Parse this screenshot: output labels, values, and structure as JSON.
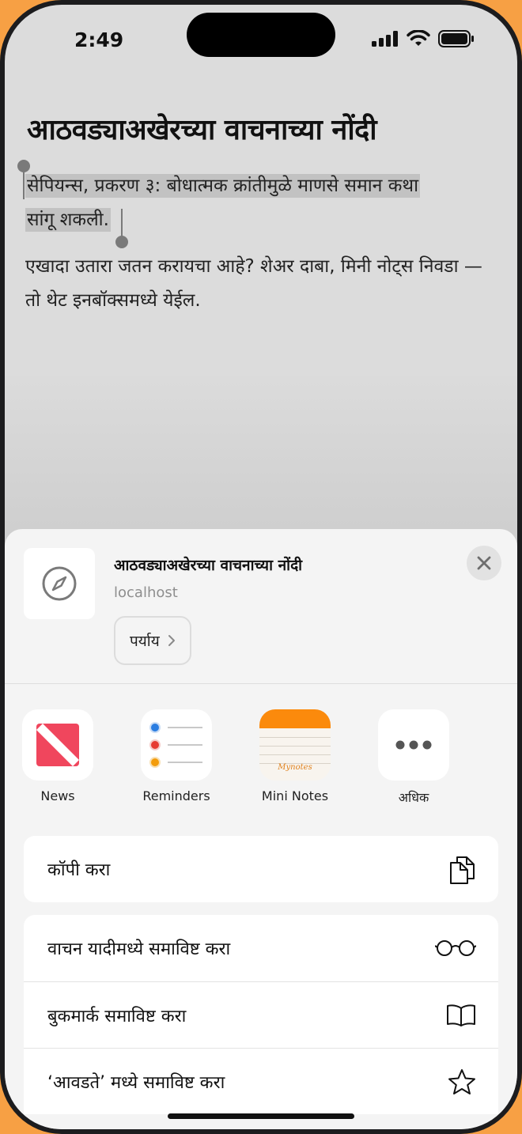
{
  "status": {
    "time": "2:49"
  },
  "page": {
    "heading": "आठवड्याअखेरच्या वाचनाच्या नोंदी",
    "selected_line1": "सेपियन्स, प्रकरण ३: बोधात्मक क्रांतीमुळे माणसे समान कथा",
    "selected_line2": "सांगू शकली.",
    "body": "एखादा उतारा जतन करायचा आहे? शेअर दाबा, मिनी नोट्स निवडा — तो थेट इनबॉक्समध्ये येईल."
  },
  "share": {
    "title": "आठवड्याअखेरच्या वाचनाच्या नोंदी",
    "host": "localhost",
    "options_label": "पर्याय",
    "apps": [
      {
        "label": "News",
        "icon": "news-icon"
      },
      {
        "label": "Reminders",
        "icon": "reminders-icon"
      },
      {
        "label": "Mini Notes",
        "icon": "mini-notes-icon",
        "badge": "Mynotes"
      },
      {
        "label": "अधिक",
        "icon": "more-icon"
      }
    ],
    "actions": {
      "copy": "कॉपी करा",
      "reading_list": "वाचन यादीमध्ये समाविष्ट करा",
      "bookmark": "बुकमार्क समाविष्ट करा",
      "favorites": "‘आवडते’ मध्ये समाविष्ट करा"
    }
  },
  "colors": {
    "accent_orange": "#f7a044",
    "news_red": "#f0465d",
    "notes_orange": "#fb8a0c"
  }
}
